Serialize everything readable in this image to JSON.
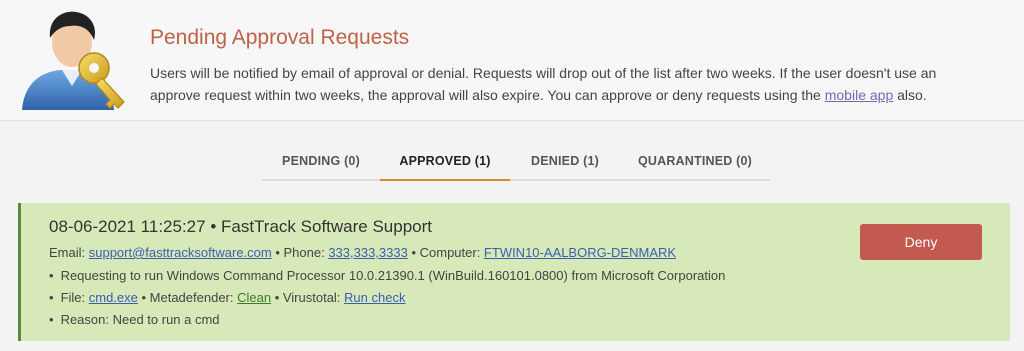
{
  "header": {
    "title": "Pending Approval Requests",
    "desc_prefix": "Users will be notified by email of approval or denial. Requests will drop out of the list after two weeks. If the user doesn't use an approve request within two weeks, the approval will also expire. You can approve or deny requests using the ",
    "mobile_app_link": "mobile app",
    "desc_suffix": " also."
  },
  "tabs": [
    {
      "label": "PENDING (0)"
    },
    {
      "label": "APPROVED (1)",
      "active": true
    },
    {
      "label": "DENIED (1)"
    },
    {
      "label": "QUARANTINED (0)"
    }
  ],
  "request": {
    "title": "08-06-2021 11:25:27 • FastTrack Software Support",
    "email_label": "Email: ",
    "email": "support@fasttracksoftware.com",
    "phone_label": " • Phone: ",
    "phone": "333,333,3333",
    "computer_label": " • Computer: ",
    "computer": "FTWIN10-AALBORG-DENMARK",
    "requesting": "Requesting to run Windows Command Processor 10.0.21390.1 (WinBuild.160101.0800) from Microsoft Corporation",
    "file_label": "File: ",
    "file": "cmd.exe",
    "metadefender_label": " • Metadefender: ",
    "metadefender": "Clean",
    "virustotal_label": " • Virustotal: ",
    "virustotal": "Run check",
    "reason": "Reason: Need to run a cmd",
    "deny_label": "Deny"
  },
  "colors": {
    "title_accent": "#c0614a",
    "card_bg": "#d8e9b9",
    "deny_bg": "#c25a4f",
    "active_tab_underline": "#d08a2a"
  },
  "icons": {
    "avatar": "user-with-key-icon"
  }
}
